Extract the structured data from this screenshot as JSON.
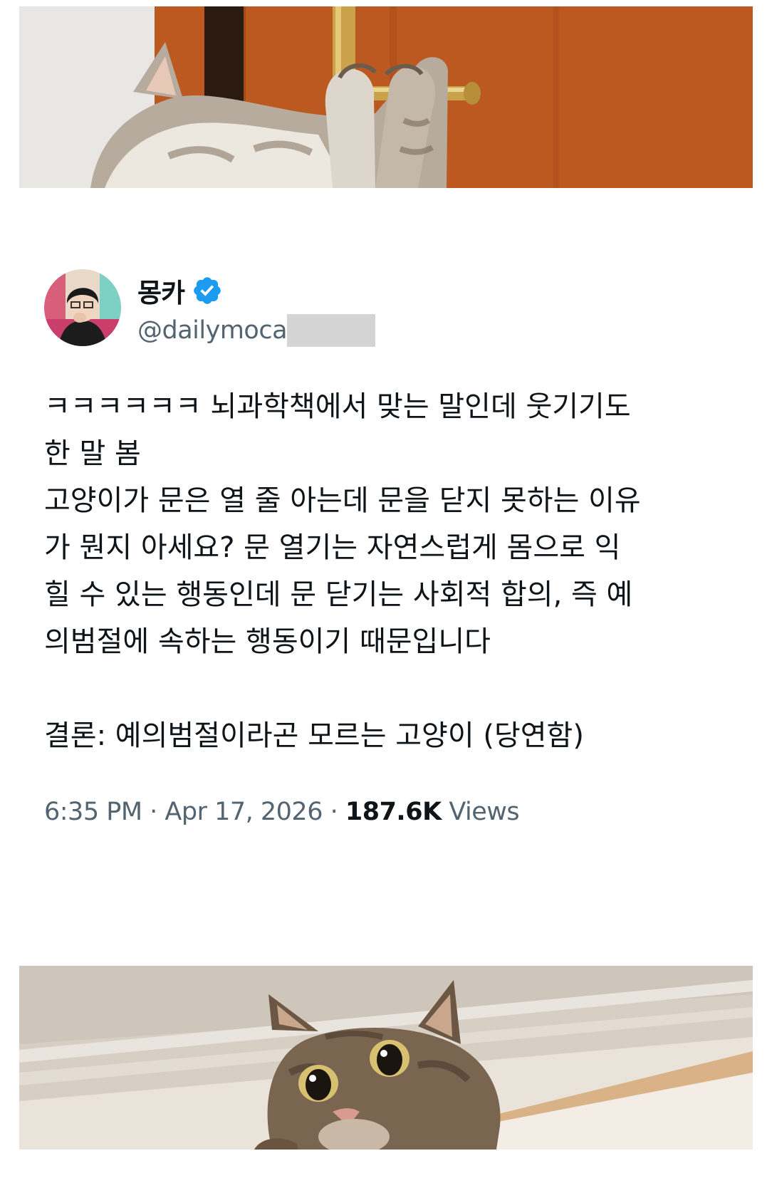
{
  "photos": {
    "top": {
      "icon": "cat-opening-door-photo"
    },
    "bottom": {
      "icon": "cat-peeking-over-door-photo"
    }
  },
  "tweet": {
    "author": {
      "display_name": "몽카",
      "handle": "@dailymoca",
      "verified": true,
      "avatar_icon": "profile-photo"
    },
    "body_lines": [
      "ㅋㅋㅋㅋㅋㅋ 뇌과학책에서 맞는 말인데 웃기기도",
      "한 말 봄",
      "고양이가 문은 열 줄 아는데 문을 닫지 못하는 이유",
      "가 뭔지 아세요? 문 열기는 자연스럽게 몸으로 익",
      "힐 수 있는 행동인데 문 닫기는 사회적 합의, 즉 예",
      "의범절에 속하는 행동이기 때문입니다"
    ],
    "conclusion": "결론: 예의범절이라곤 모르는 고양이 (당연함)",
    "meta": {
      "time": "6:35 PM",
      "separator": " · ",
      "date": "Apr 17, 2026",
      "views_count": "187.6K",
      "views_label": " Views"
    }
  },
  "colors": {
    "text": "#0f1419",
    "secondary": "#536471",
    "verified_blue": "#1d9bf0",
    "redaction": "#d4d4d4"
  }
}
